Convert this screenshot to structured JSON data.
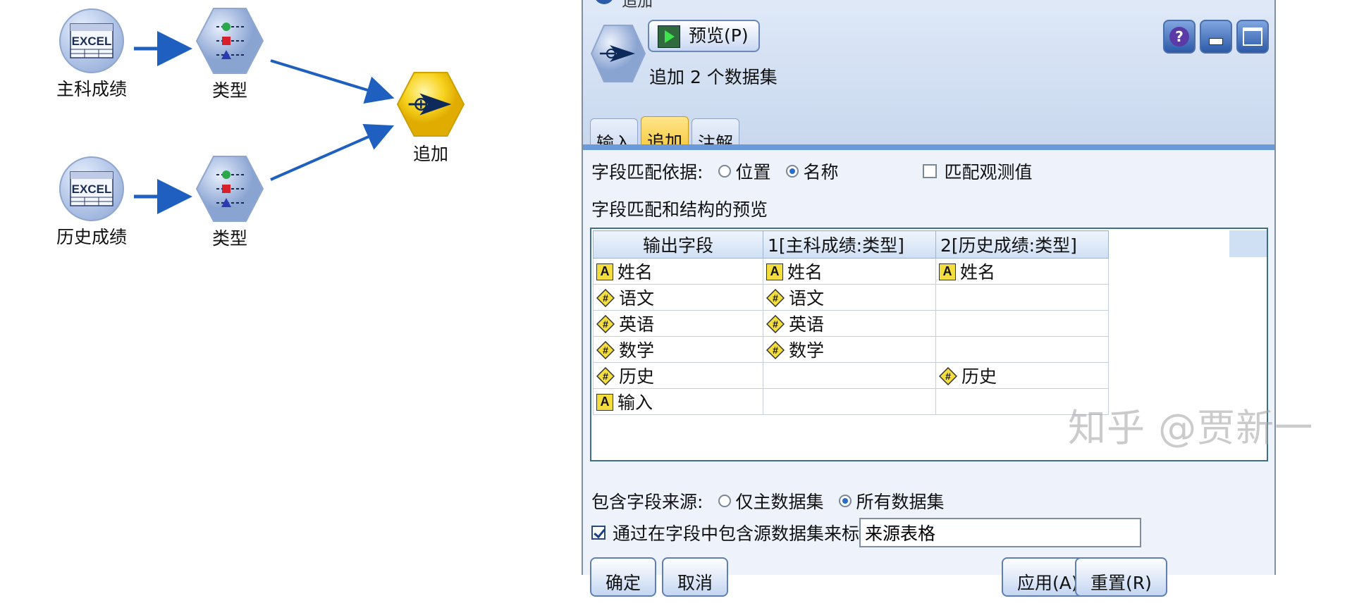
{
  "canvas": {
    "nodes": [
      {
        "label": "主科成绩",
        "type": "excel-source"
      },
      {
        "label": "类型",
        "type": "type"
      },
      {
        "label": "历史成绩",
        "type": "excel-source"
      },
      {
        "label": "类型",
        "type": "type"
      },
      {
        "label": "追加",
        "type": "append"
      }
    ],
    "excel_text": "EXCEL"
  },
  "dialog": {
    "title": "追加",
    "preview_button": "预览(P)",
    "description": "追加 2 个数据集",
    "tabs": [
      "输入",
      "追加",
      "注解"
    ],
    "active_tab": "追加",
    "match_by": {
      "label": "字段匹配依据:",
      "options": [
        "位置",
        "名称"
      ],
      "selected": "名称"
    },
    "match_values": {
      "label": "匹配观测值",
      "checked": false
    },
    "preview_label": "字段匹配和结构的预览",
    "grid": {
      "columns": [
        "输出字段",
        "1[主科成绩:类型]",
        "2[历史成绩:类型]"
      ],
      "rows": [
        [
          {
            "icon": "string",
            "text": "姓名"
          },
          {
            "icon": "string",
            "text": "姓名"
          },
          {
            "icon": "string",
            "text": "姓名"
          }
        ],
        [
          {
            "icon": "numeric",
            "text": "语文"
          },
          {
            "icon": "numeric",
            "text": "语文"
          },
          {
            "icon": "",
            "text": ""
          }
        ],
        [
          {
            "icon": "numeric",
            "text": "英语"
          },
          {
            "icon": "numeric",
            "text": "英语"
          },
          {
            "icon": "",
            "text": ""
          }
        ],
        [
          {
            "icon": "numeric",
            "text": "数学"
          },
          {
            "icon": "numeric",
            "text": "数学"
          },
          {
            "icon": "",
            "text": ""
          }
        ],
        [
          {
            "icon": "numeric",
            "text": "历史"
          },
          {
            "icon": "",
            "text": ""
          },
          {
            "icon": "numeric",
            "text": "历史"
          }
        ],
        [
          {
            "icon": "string",
            "text": "输入"
          },
          {
            "icon": "",
            "text": ""
          },
          {
            "icon": "",
            "text": ""
          }
        ]
      ]
    },
    "include_source": {
      "label": "包含字段来源:",
      "options": [
        "仅主数据集",
        "所有数据集"
      ],
      "selected": "所有数据集"
    },
    "tag_records": {
      "label": "通过在字段中包含源数据集来标记记录",
      "checked": true,
      "value": "来源表格"
    },
    "buttons": {
      "ok": "确定",
      "cancel": "取消",
      "apply": "应用(A)",
      "reset": "重置(R)"
    }
  },
  "watermark": "知乎 @贾新一",
  "colors": {
    "arrow": "#1f5fbf",
    "append_node": "#f5c800",
    "active_tab": "#f4c12a"
  }
}
